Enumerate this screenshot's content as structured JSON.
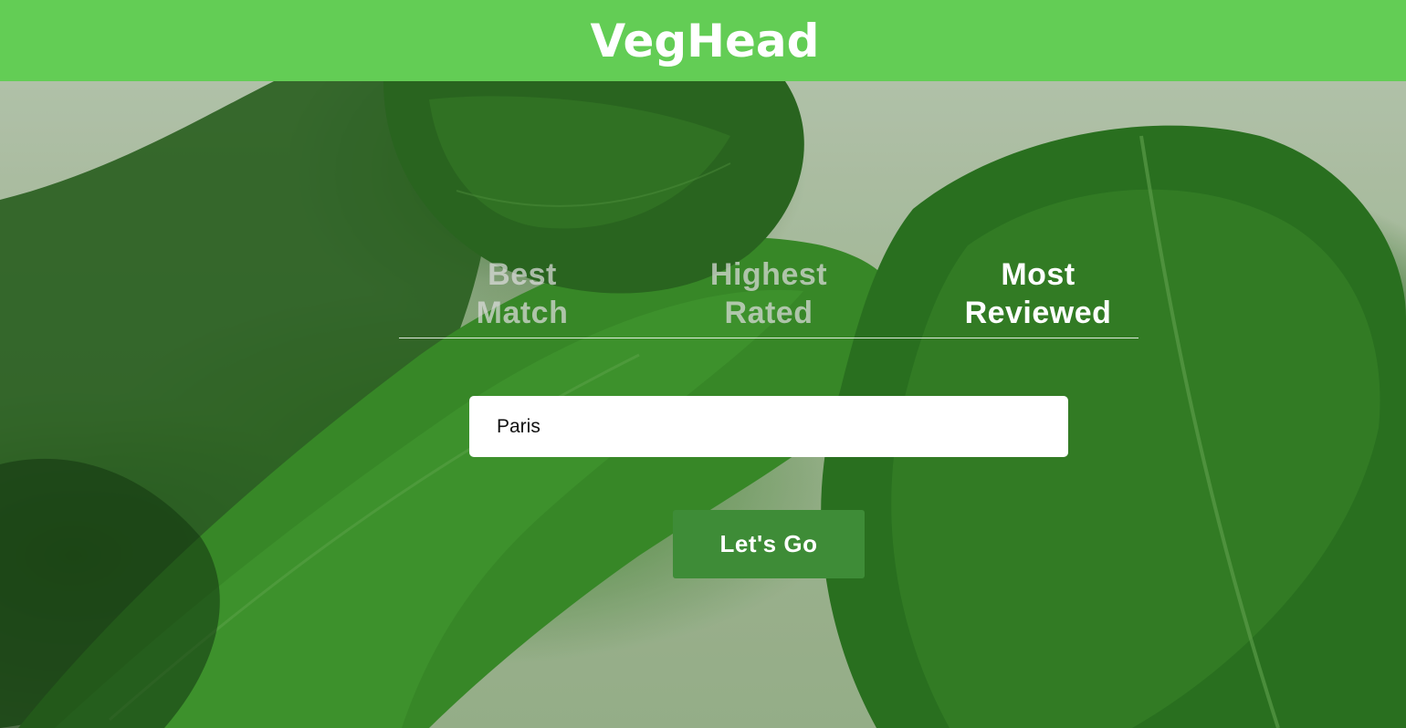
{
  "header": {
    "logo_text": "VegHead",
    "background_color": "#63cd55"
  },
  "hero": {
    "background_description_icon": "spinach-leaves-photo"
  },
  "sort_tabs": [
    {
      "label": "Best\nMatch",
      "active": false
    },
    {
      "label": "Highest\nRated",
      "active": false
    },
    {
      "label": "Most\nReviewed",
      "active": true
    }
  ],
  "search": {
    "value": "Paris"
  },
  "submit_button": {
    "label": "Let's Go",
    "color": "#3e8c37"
  }
}
